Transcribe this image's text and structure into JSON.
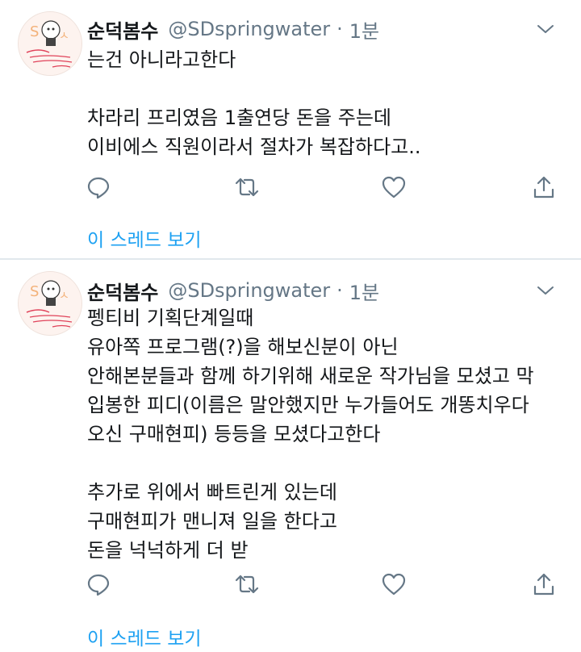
{
  "tweets": [
    {
      "author_name": "순덕봄수",
      "handle": "@SDspringwater",
      "separator": "·",
      "time": "1분",
      "text_lines": [
        "는건 아니라고한다",
        "",
        "차라리 프리였음 1출연당 돈을 주는데",
        "이비에스 직원이라서 절차가 복잡하다고.."
      ],
      "show_thread": "이 스레드 보기"
    },
    {
      "author_name": "순덕봄수",
      "handle": "@SDspringwater",
      "separator": "·",
      "time": "1분",
      "text_lines": [
        "펭티비 기획단계일때",
        "유아쪽 프로그램(?)을 해보신분이 아닌",
        "안해본분들과 함께 하기위해 새로운 작가님을 모셨고 막",
        "입봉한 피디(이름은 말안했지만 누가들어도 개똥치우다",
        "오신 구매현피) 등등을 모셨다고한다",
        "",
        "추가로 위에서 빠트린게 있는데",
        "구매현피가 맨니져 일을 한다고",
        "돈을 넉넉하게 더 받"
      ],
      "show_thread": "이 스레드 보기"
    }
  ],
  "icons": {
    "reply": "reply-icon",
    "retweet": "retweet-icon",
    "like": "heart-icon",
    "share": "share-icon",
    "menu": "chevron-down-icon"
  },
  "colors": {
    "text": "#14171a",
    "secondary": "#657786",
    "link": "#1da1f2",
    "divider": "#e1e8ed"
  }
}
